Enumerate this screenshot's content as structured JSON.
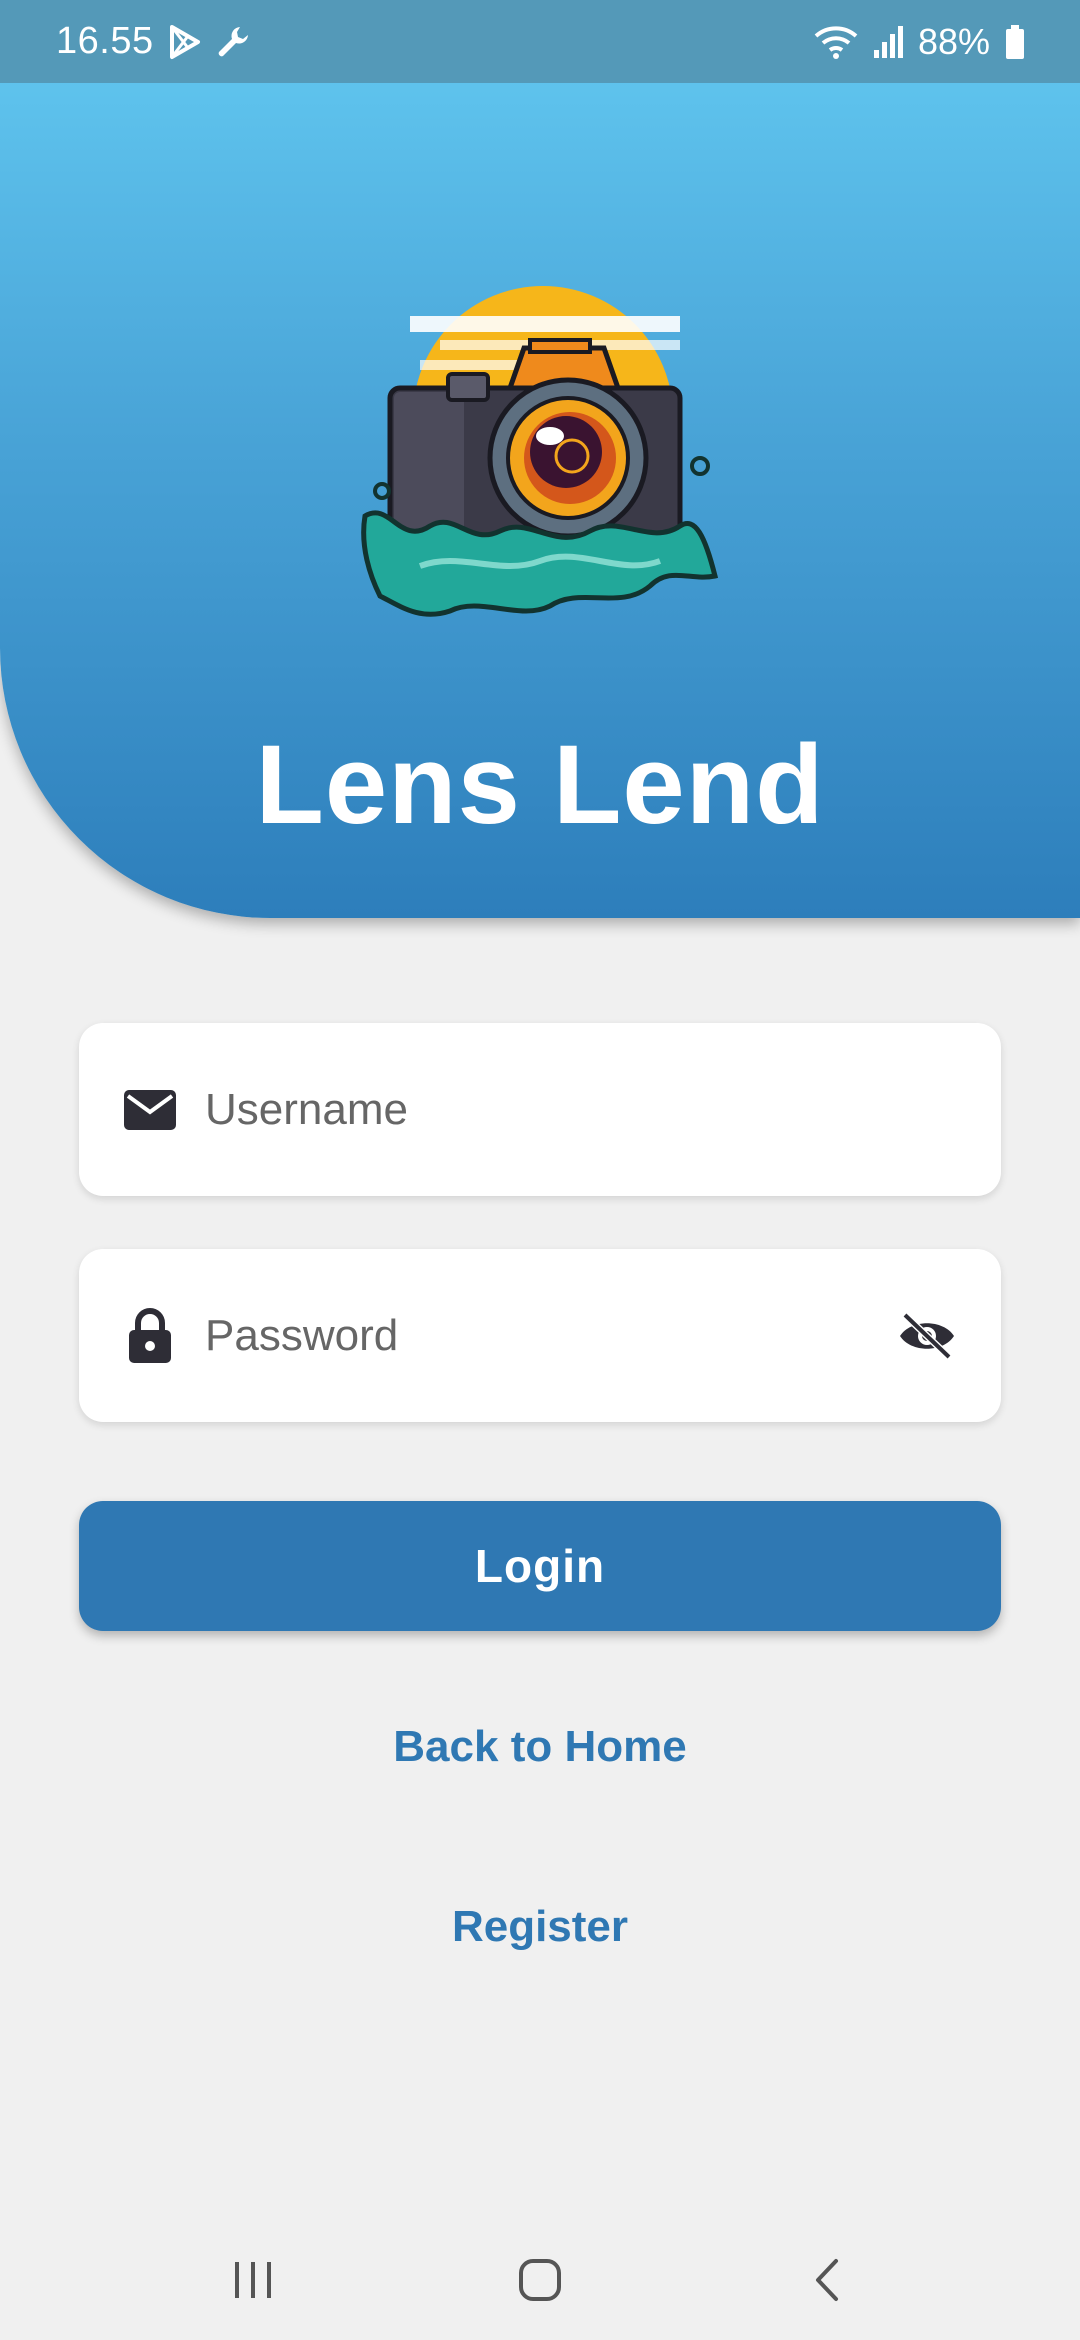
{
  "status_bar": {
    "time": "16.55",
    "battery_percent": "88%",
    "icons": [
      "play-store-icon",
      "wrench-icon",
      "wifi-icon",
      "signal-icon",
      "battery-icon"
    ]
  },
  "header": {
    "logo_icon": "camera-splash-logo",
    "title": "Lens Lend"
  },
  "form": {
    "username": {
      "placeholder": "Username",
      "value": "",
      "icon": "mail-icon"
    },
    "password": {
      "placeholder": "Password",
      "value": "",
      "icon": "lock-icon",
      "toggle_icon": "eye-off-icon"
    },
    "login_label": "Login"
  },
  "links": {
    "back_home": "Back to Home",
    "register": "Register"
  },
  "nav": {
    "icons": [
      "recent-apps-icon",
      "home-icon",
      "back-icon"
    ]
  },
  "colors": {
    "primary": "#2f78b3",
    "header_top": "#63caf2",
    "header_bottom": "#2d7ebb",
    "background": "#f0f0f0",
    "status_bar": "#5499b8"
  }
}
